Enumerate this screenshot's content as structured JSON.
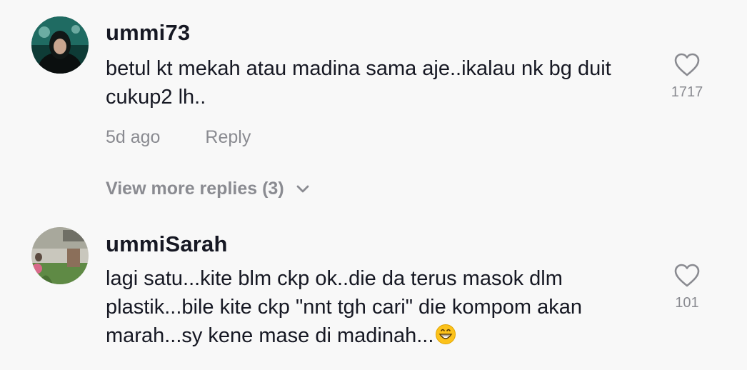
{
  "comments": [
    {
      "username": "ummi73",
      "text": "betul kt mekah atau madina sama aje..ikalau nk bg duit cukup2 lh..",
      "time": "5d ago",
      "reply_label": "Reply",
      "like_count": "1717"
    },
    {
      "username": "ummiSarah",
      "text": "lagi satu...kite blm ckp ok..die da terus masok dlm plastik...bile kite ckp \"nnt tgh cari\" die kompom akan marah...sy kene mase di madinah...",
      "like_count": "101",
      "emoji": "grinning-face"
    }
  ],
  "view_more_replies": "View more replies (3)",
  "icons": {
    "like": "heart-outline-icon",
    "expand": "chevron-down-icon"
  },
  "colors": {
    "text_primary": "#161823",
    "text_secondary": "#8a8b91",
    "background": "#f8f8f8"
  }
}
